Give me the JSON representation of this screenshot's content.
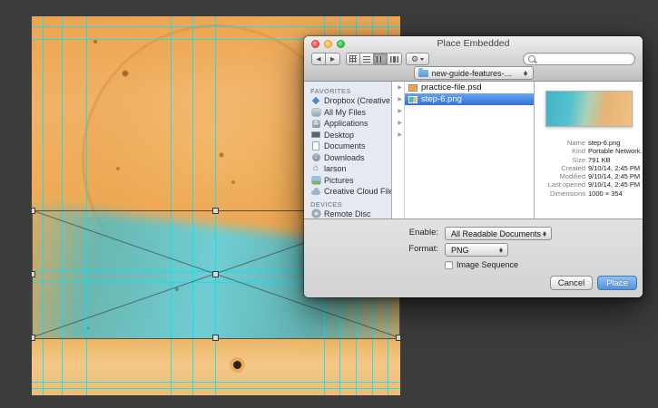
{
  "window": {
    "title": "Place Embedded",
    "path_popup": "new-guide-features-…"
  },
  "sidebar": {
    "favorites_header": "FAVORITES",
    "devices_header": "DEVICES",
    "favorites": [
      {
        "label": "Dropbox (Creative Cl…",
        "icon": "dropbox-icon"
      },
      {
        "label": "All My Files",
        "icon": "all-my-files-icon"
      },
      {
        "label": "Applications",
        "icon": "applications-icon"
      },
      {
        "label": "Desktop",
        "icon": "desktop-icon"
      },
      {
        "label": "Documents",
        "icon": "documents-icon"
      },
      {
        "label": "Downloads",
        "icon": "downloads-icon"
      },
      {
        "label": "larson",
        "icon": "home-icon"
      },
      {
        "label": "Pictures",
        "icon": "pictures-icon"
      },
      {
        "label": "Creative Cloud Files",
        "icon": "cloud-icon"
      }
    ],
    "devices": [
      {
        "label": "Remote Disc",
        "icon": "disc-icon"
      }
    ]
  },
  "file_list": {
    "items": [
      {
        "name": "practice-file.psd",
        "icon": "psd-thumbnail-icon",
        "selected": false
      },
      {
        "name": "step-6.png",
        "icon": "png-thumbnail-icon",
        "selected": true
      }
    ]
  },
  "preview": {
    "metadata": [
      {
        "label": "Name",
        "value": "step-6.png"
      },
      {
        "label": "Kind",
        "value": "Portable Network…"
      },
      {
        "label": "Size",
        "value": "791 KB"
      },
      {
        "label": "Created",
        "value": "9/10/14, 2:45 PM"
      },
      {
        "label": "Modified",
        "value": "9/10/14, 2:45 PM"
      },
      {
        "label": "Last opened",
        "value": "9/10/14, 2:45 PM"
      },
      {
        "label": "Dimensions",
        "value": "1000 × 354"
      }
    ]
  },
  "form": {
    "enable_label": "Enable:",
    "enable_value": "All Readable Documents",
    "format_label": "Format:",
    "format_value": "PNG",
    "image_sequence_label": "Image Sequence"
  },
  "buttons": {
    "cancel": "Cancel",
    "place": "Place"
  },
  "icons": {
    "back": "◀",
    "forward": "▶",
    "gear": "⚙",
    "disclosure": "▶"
  },
  "colors": {
    "selection_blue": "#3172d8",
    "place_button_blue": "#5291de",
    "guide_cyan": "#00e4ff"
  }
}
